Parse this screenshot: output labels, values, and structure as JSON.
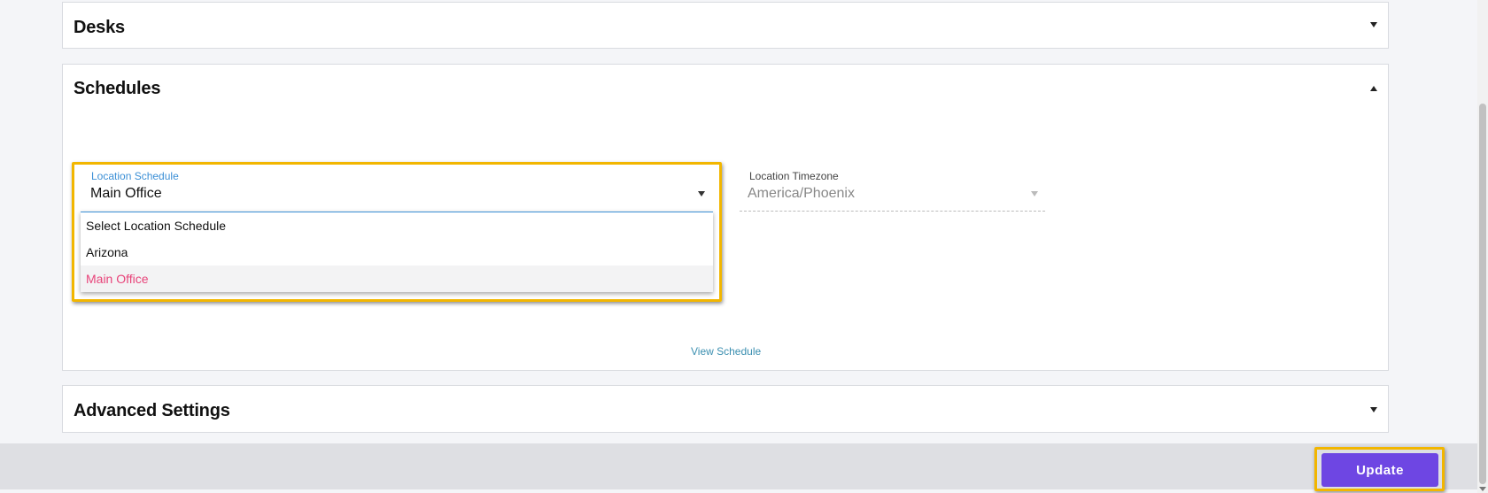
{
  "panels": {
    "desks": {
      "title": "Desks"
    },
    "schedules": {
      "title": "Schedules"
    },
    "advanced": {
      "title": "Advanced Settings"
    }
  },
  "location_schedule": {
    "label": "Location Schedule",
    "value": "Main Office",
    "options": [
      "Select Location Schedule",
      "Arizona",
      "Main Office"
    ],
    "selected_option": "Main Office"
  },
  "location_timezone": {
    "label": "Location Timezone",
    "value": "America/Phoenix"
  },
  "view_schedule_link": "View Schedule",
  "footer": {
    "update_label": "Update"
  },
  "colors": {
    "accent": "#6e46e3",
    "highlight": "#f2b600",
    "selected_option": "#e8447a",
    "label_blue": "#3b8fd6"
  }
}
